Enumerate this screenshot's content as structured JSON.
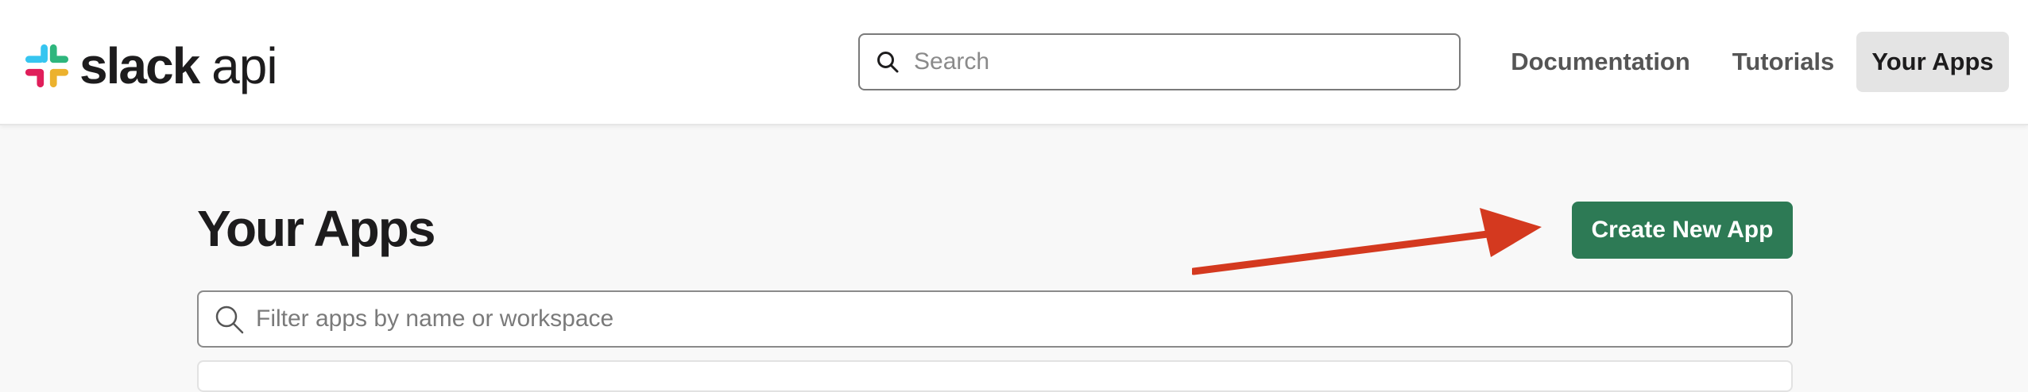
{
  "header": {
    "logo": {
      "wordmark": "slack",
      "suffix": "api",
      "icon": "slack-logo-icon"
    },
    "search": {
      "placeholder": "Search",
      "icon": "search-icon"
    },
    "nav": [
      {
        "label": "Documentation"
      },
      {
        "label": "Tutorials"
      },
      {
        "label": "Your Apps",
        "active": true
      }
    ]
  },
  "main": {
    "title": "Your Apps",
    "create_button_label": "Create New App",
    "filter": {
      "placeholder": "Filter apps by name or workspace",
      "icon": "search-icon"
    },
    "annotation": {
      "type": "arrow",
      "color": "#d4391f",
      "points_to": "create-new-app-button"
    }
  },
  "colors": {
    "brand_green": "#2d7a55",
    "active_nav_bg": "#e4e4e4",
    "page_bg": "#f8f8f8",
    "arrow": "#d4391f"
  }
}
